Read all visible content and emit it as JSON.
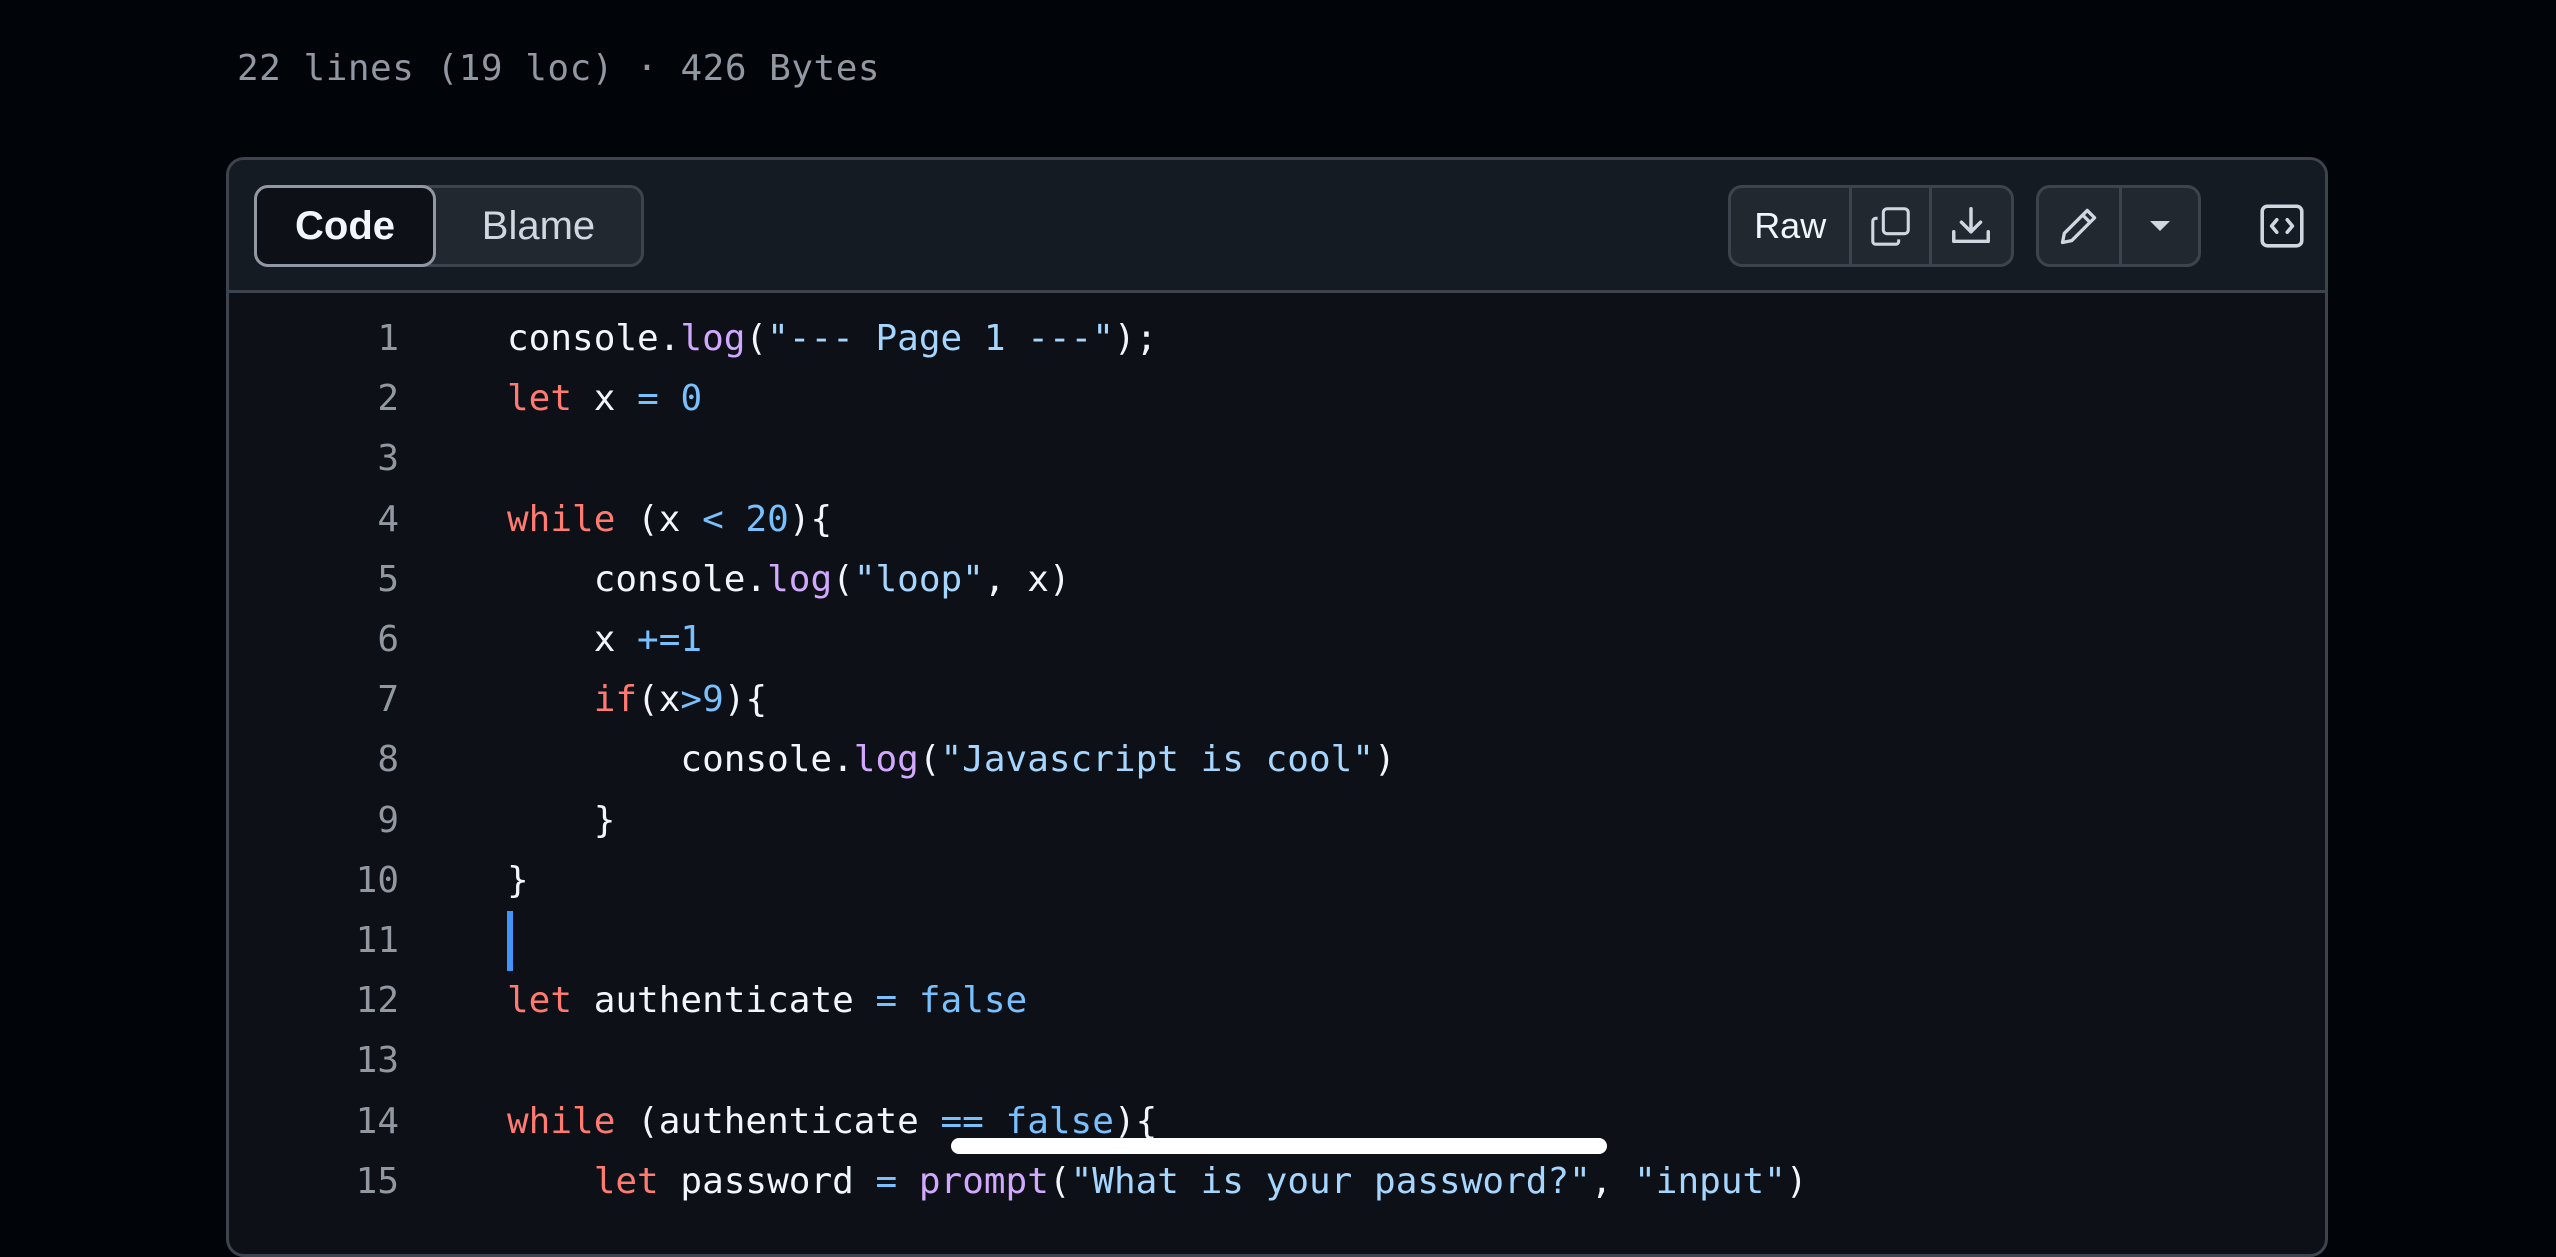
{
  "file_info": "22 lines (19 loc) · 426 Bytes",
  "toolbar": {
    "code_tab": "Code",
    "blame_tab": "Blame",
    "raw_label": "Raw",
    "icons": {
      "copy": "copy-icon",
      "download": "download-icon",
      "edit": "pencil-icon",
      "more": "triangle-down-icon",
      "symbols": "code-square-icon"
    }
  },
  "code": {
    "lines": [
      {
        "n": "1",
        "tokens": [
          [
            "",
            "console."
          ],
          [
            "fn",
            "log"
          ],
          [
            "",
            "("
          ],
          [
            "str",
            "\"--- Page 1 ---\""
          ],
          [
            "",
            ");"
          ]
        ]
      },
      {
        "n": "2",
        "tokens": [
          [
            "kw",
            "let"
          ],
          [
            "",
            " x "
          ],
          [
            "op",
            "="
          ],
          [
            "",
            " "
          ],
          [
            "num",
            "0"
          ]
        ]
      },
      {
        "n": "3",
        "tokens": []
      },
      {
        "n": "4",
        "tokens": [
          [
            "kw",
            "while"
          ],
          [
            "",
            " (x "
          ],
          [
            "op",
            "<"
          ],
          [
            "",
            " "
          ],
          [
            "num",
            "20"
          ],
          [
            "",
            "){"
          ]
        ]
      },
      {
        "n": "5",
        "tokens": [
          [
            "",
            "    console."
          ],
          [
            "fn",
            "log"
          ],
          [
            "",
            "("
          ],
          [
            "str",
            "\"loop\""
          ],
          [
            "",
            ", x)"
          ]
        ]
      },
      {
        "n": "6",
        "tokens": [
          [
            "",
            "    x "
          ],
          [
            "op",
            "+="
          ],
          [
            "num",
            "1"
          ]
        ]
      },
      {
        "n": "7",
        "tokens": [
          [
            "",
            "    "
          ],
          [
            "kw",
            "if"
          ],
          [
            "",
            "(x"
          ],
          [
            "op",
            ">"
          ],
          [
            "num",
            "9"
          ],
          [
            "",
            "){"
          ]
        ]
      },
      {
        "n": "8",
        "tokens": [
          [
            "",
            "        console."
          ],
          [
            "fn",
            "log"
          ],
          [
            "",
            "("
          ],
          [
            "str",
            "\"Javascript is cool\""
          ],
          [
            "",
            ")"
          ]
        ]
      },
      {
        "n": "9",
        "tokens": [
          [
            "",
            "    }"
          ]
        ]
      },
      {
        "n": "10",
        "tokens": [
          [
            "",
            "}"
          ]
        ]
      },
      {
        "n": "11",
        "tokens": [],
        "cursor": true
      },
      {
        "n": "12",
        "tokens": [
          [
            "kw",
            "let"
          ],
          [
            "",
            " authenticate "
          ],
          [
            "op",
            "="
          ],
          [
            "",
            " "
          ],
          [
            "num",
            "false"
          ]
        ]
      },
      {
        "n": "13",
        "tokens": []
      },
      {
        "n": "14",
        "tokens": [
          [
            "kw",
            "while"
          ],
          [
            "",
            " (authenticate "
          ],
          [
            "op",
            "=="
          ],
          [
            "",
            " "
          ],
          [
            "num",
            "false"
          ],
          [
            "",
            "){"
          ]
        ]
      },
      {
        "n": "15",
        "tokens": [
          [
            "",
            "    "
          ],
          [
            "kw",
            "let"
          ],
          [
            "",
            " password "
          ],
          [
            "op",
            "="
          ],
          [
            "",
            " "
          ],
          [
            "fn",
            "prompt"
          ],
          [
            "",
            "("
          ],
          [
            "str",
            "\"What is your password?\""
          ],
          [
            "",
            ", "
          ],
          [
            "str",
            "\"input\""
          ],
          [
            "",
            ")"
          ]
        ]
      }
    ]
  },
  "colors": {
    "background": "#010409",
    "panel": "#0d1117",
    "toolbar": "#151b23",
    "border": "#3d444d",
    "keyword": "#ff7b72",
    "string": "#a5d6ff",
    "number": "#79c0ff",
    "function": "#d2a8ff",
    "cursor": "#4493f8"
  }
}
